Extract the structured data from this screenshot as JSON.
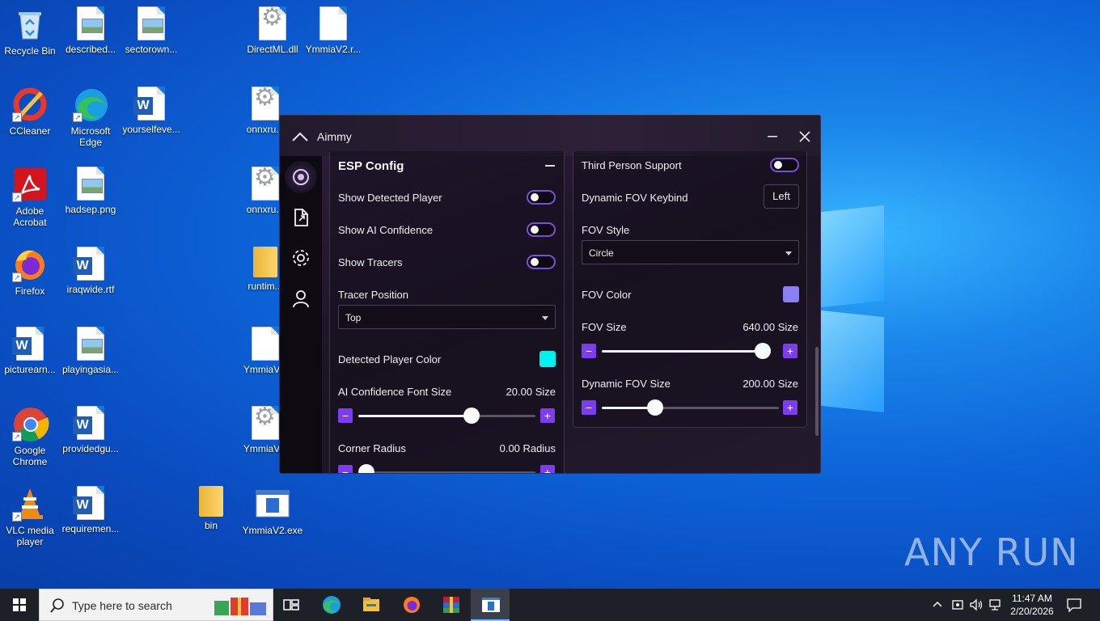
{
  "desktop": {
    "icons": [
      {
        "label": "Recycle Bin"
      },
      {
        "label": "described..."
      },
      {
        "label": "sectorown..."
      },
      {
        "label": "DirectML.dll"
      },
      {
        "label": "YmmiaV2.r..."
      },
      {
        "label": "CCleaner"
      },
      {
        "label": "Microsoft Edge"
      },
      {
        "label": "yourselfeve..."
      },
      {
        "label": "onnxru..."
      },
      {
        "label": "Adobe Acrobat"
      },
      {
        "label": "hadsep.png"
      },
      {
        "label": "onnxru..."
      },
      {
        "label": "Firefox"
      },
      {
        "label": "iraqwide.rtf"
      },
      {
        "label": "runtim..."
      },
      {
        "label": "picturearn..."
      },
      {
        "label": "playingasia..."
      },
      {
        "label": "YmmiaV..."
      },
      {
        "label": "Google Chrome"
      },
      {
        "label": "providedgu..."
      },
      {
        "label": "YmmiaV..."
      },
      {
        "label": "VLC media player"
      },
      {
        "label": "requiremen..."
      },
      {
        "label": "bin"
      },
      {
        "label": "YmmiaV2.exe"
      }
    ]
  },
  "app": {
    "title": "Aimmy",
    "left_panel": {
      "heading": "ESP Config",
      "toggles": [
        {
          "label": "Show Detected Player",
          "on": false
        },
        {
          "label": "Show AI Confidence",
          "on": false
        },
        {
          "label": "Show Tracers",
          "on": false
        }
      ],
      "tracer_position": {
        "label": "Tracer Position",
        "value": "Top"
      },
      "detected_player_color": {
        "label": "Detected Player Color",
        "color": "#00f0f0"
      },
      "ai_confidence_font_size": {
        "label": "AI Confidence Font Size",
        "value_text": "20.00 Size",
        "value": 20,
        "fraction": 0.64
      },
      "corner_radius": {
        "label": "Corner Radius",
        "value_text": "0.00 Radius",
        "value": 0,
        "fraction": 0.0
      }
    },
    "right_panel": {
      "third_person": {
        "label": "Third Person Support",
        "on": false
      },
      "dynamic_fov_keybind": {
        "label": "Dynamic FOV Keybind",
        "value": "Left"
      },
      "fov_style": {
        "label": "FOV Style",
        "value": "Circle"
      },
      "fov_color": {
        "label": "FOV Color",
        "color": "#8a80f5"
      },
      "fov_size": {
        "label": "FOV Size",
        "value_text": "640.00 Size",
        "value": 640,
        "fraction": 1.0
      },
      "dynamic_fov_size": {
        "label": "Dynamic FOV Size",
        "value_text": "200.00 Size",
        "value": 200,
        "fraction": 0.3
      }
    },
    "stepper": {
      "minus": "−",
      "plus": "+"
    }
  },
  "taskbar": {
    "search_placeholder": "Type here to search",
    "time": "11:47 AM",
    "date": "2/20/2026"
  },
  "watermark": "ANY RUN",
  "colors": {
    "accent": "#7d3cf0",
    "toggle_border": "#7a4fd6"
  }
}
